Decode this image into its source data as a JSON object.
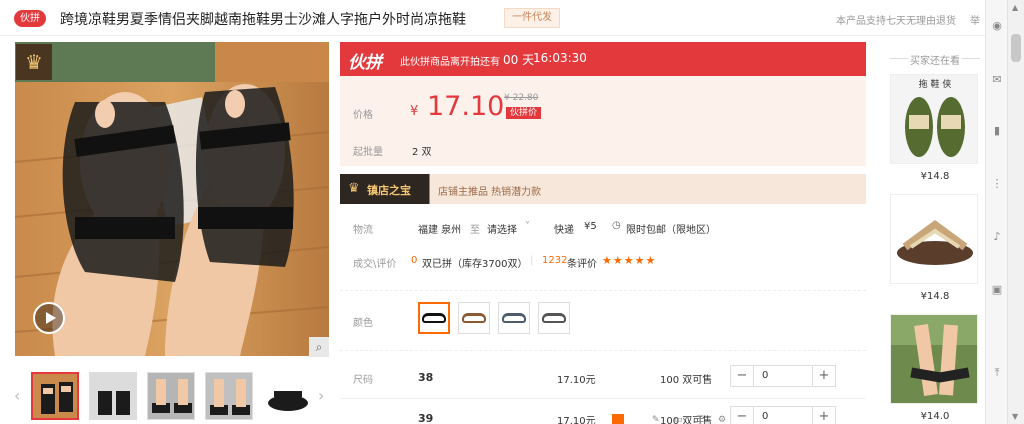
{
  "header": {
    "badge": "伙拼",
    "title": "跨境凉鞋男夏季情侣夹脚越南拖鞋男士沙滩人字拖户外时尚凉拖鞋",
    "dropship_tag": "一件代发",
    "return_note": "本产品支持七天无理由退货",
    "return_extra": "举"
  },
  "gallery": {
    "crown_icon": "crown-icon",
    "play_icon": "play-icon",
    "zoom_icon": "magnifier-icon",
    "prev_arrow": "‹",
    "next_arrow": "›",
    "thumbnails": [
      "thumb-1",
      "thumb-2",
      "thumb-3",
      "thumb-4",
      "thumb-5"
    ]
  },
  "countdown": {
    "logo": "伙拼",
    "text": "此伙拼商品离开拍还有",
    "days": "00 天",
    "time": "16:03:30"
  },
  "price": {
    "label": "价格",
    "currency": "¥",
    "value": "17.10",
    "original": "¥ 22.80",
    "tag": "伙拼价",
    "moq_label": "起批量",
    "moq_value": "2 双"
  },
  "treasure": {
    "title": "镇店之宝",
    "tags": "店铺主推品   热销潜力款"
  },
  "logistics": {
    "label": "物流",
    "origin": "福建 泉州",
    "to": "至",
    "dest": "请选择",
    "carrier": "快递",
    "fee": "¥5",
    "promo": "限时包邮（限地区）"
  },
  "deals": {
    "label": "成交\\评价",
    "sold_count": "0",
    "sold_text": "双已拼（库存3700双）",
    "review_count": "1232",
    "review_text": "条评价",
    "stars": "★★★★★"
  },
  "color": {
    "label": "颜色",
    "options": [
      "black",
      "brown",
      "blue-gray",
      "gray"
    ]
  },
  "sizes": {
    "label": "尺码",
    "rows": [
      {
        "size": "38",
        "price": "17.10元",
        "stock": "100 双可售",
        "qty": "0"
      },
      {
        "size": "39",
        "price": "17.10元",
        "stock": "100 双可售",
        "qty": "0"
      }
    ],
    "minus": "−",
    "plus": "+"
  },
  "rail": {
    "title": "买家还在看",
    "items": [
      {
        "price": "¥14.8",
        "label": "拖 鞋 侠"
      },
      {
        "price": "¥14.8",
        "label": ""
      },
      {
        "price": "¥14.0",
        "label": ""
      }
    ]
  },
  "colors": {
    "accent": "#e4393c",
    "orange": "#ff6a00"
  }
}
